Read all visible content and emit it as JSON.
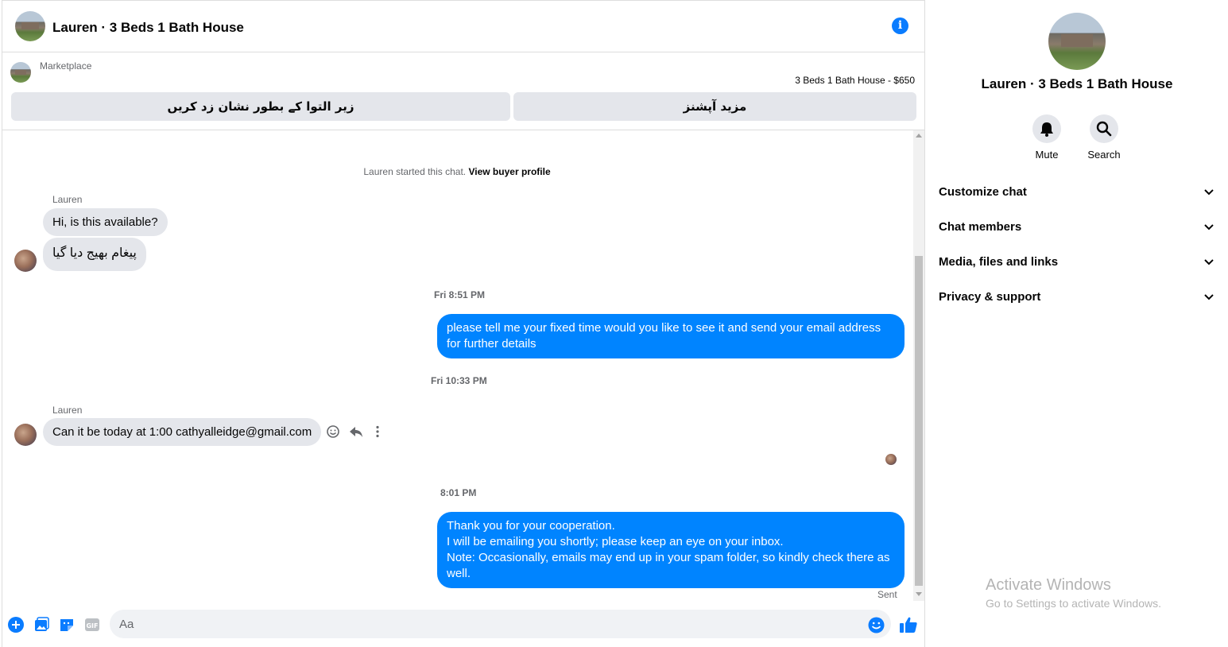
{
  "header": {
    "title": "Lauren · 3 Beds 1 Bath House"
  },
  "marketplace": {
    "label": "Marketplace",
    "listing": "3 Beds 1 Bath House - $650",
    "mark_as_read_label": "زیر التوا کے بطور نشان زد کریں",
    "more_options_label": "مزید آپشنز"
  },
  "conversation": {
    "started_text": "Lauren started this chat.",
    "view_profile_link": "View buyer profile",
    "messages": [
      {
        "sender": "Lauren",
        "text": "Hi, is this available?"
      },
      {
        "text": "پیغام بھیج دیا گیا"
      },
      {
        "timestamp": "Fri 8:51 PM"
      },
      {
        "text_line1": "please tell me your fixed time would you like to see it and send your email address",
        "text_line2": "for further details"
      },
      {
        "timestamp": "Fri 10:33 PM"
      },
      {
        "sender": "Lauren",
        "text": "Can it be today at 1:00 cathyalleidge@gmail.com"
      },
      {
        "timestamp": "8:01 PM"
      },
      {
        "line1": "Thank you for your cooperation.",
        "line2": "I will be emailing you shortly; please keep an eye on your inbox.",
        "line3": "Note: Occasionally, emails may end up in your spam folder, so kindly check there as",
        "line4": "well."
      }
    ],
    "sent_status": "Sent"
  },
  "composer": {
    "placeholder": "Aa",
    "gif_label": "GIF"
  },
  "panel": {
    "name": "Lauren · 3 Beds 1 Bath House",
    "mute_label": "Mute",
    "search_label": "Search",
    "menu": [
      "Customize chat",
      "Chat members",
      "Media, files and links",
      "Privacy & support"
    ]
  },
  "watermark": {
    "title": "Activate Windows",
    "subtitle": "Go to Settings to activate Windows."
  },
  "colors": {
    "accent": "#0084ff",
    "icon_blue": "#0a7cff",
    "bubble_in": "#e4e6eb"
  }
}
